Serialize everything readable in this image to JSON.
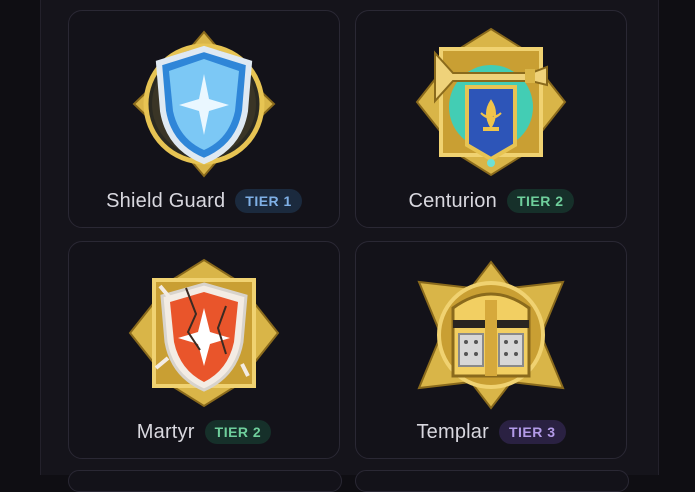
{
  "cards": [
    {
      "name": "Shield Guard",
      "tier": "TIER 1",
      "icon": "shield-icon"
    },
    {
      "name": "Centurion",
      "tier": "TIER 2",
      "icon": "trumpet-banner-icon"
    },
    {
      "name": "Martyr",
      "tier": "TIER 2",
      "icon": "cracked-shield-icon"
    },
    {
      "name": "Templar",
      "tier": "TIER 3",
      "icon": "knight-helmet-icon"
    }
  ],
  "colors": {
    "tier1": "#7fb0e6",
    "tier2": "#6fcf9c",
    "tier3": "#b39be8",
    "gold": "#e7c453"
  }
}
